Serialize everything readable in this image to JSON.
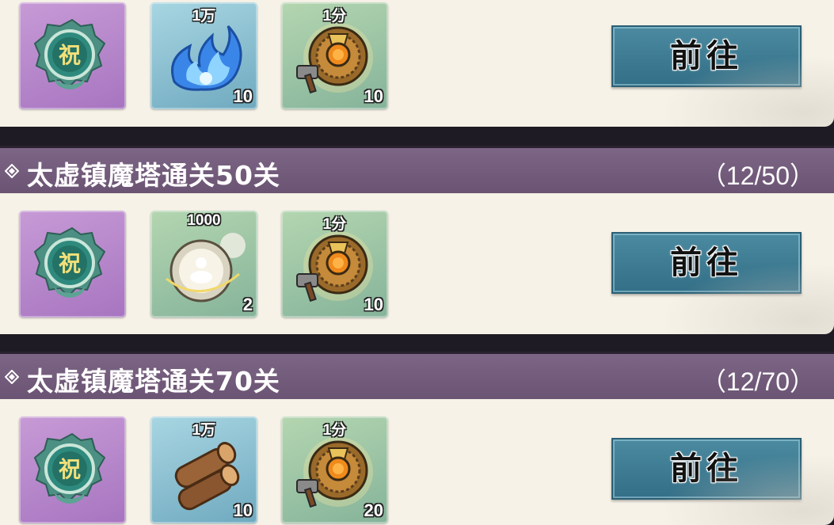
{
  "tasks": [
    {
      "title": "",
      "progress": "",
      "rewards": [
        {
          "icon": "blessing-token-icon",
          "top_label": "",
          "count": ""
        },
        {
          "icon": "blue-flame-icon",
          "top_label": "1万",
          "count": "10"
        },
        {
          "icon": "bronze-compass-hammer-icon",
          "top_label": "1分",
          "count": "10"
        }
      ],
      "button_label": "前往"
    },
    {
      "title": "太虚镇魔塔通关50关",
      "progress": "（12/50）",
      "rewards": [
        {
          "icon": "blessing-token-icon",
          "top_label": "",
          "count": ""
        },
        {
          "icon": "meditation-orb-icon",
          "top_label": "1000",
          "count": "2"
        },
        {
          "icon": "bronze-compass-hammer-icon",
          "top_label": "1分",
          "count": "10"
        }
      ],
      "button_label": "前往"
    },
    {
      "title": "太虚镇魔塔通关70关",
      "progress": "（12/70）",
      "rewards": [
        {
          "icon": "blessing-token-icon",
          "top_label": "",
          "count": ""
        },
        {
          "icon": "wood-logs-icon",
          "top_label": "1万",
          "count": "10"
        },
        {
          "icon": "bronze-compass-hammer-icon",
          "top_label": "1分",
          "count": "20"
        }
      ],
      "button_label": "前往"
    }
  ],
  "colors": {
    "card_bg": "#f6f2e8",
    "header_bg": "#6b5473",
    "button_bg": "#3d7d94",
    "purple_slot": "#b585ca",
    "blue_slot": "#8dc0d2",
    "green_slot": "#9cc6a5"
  }
}
